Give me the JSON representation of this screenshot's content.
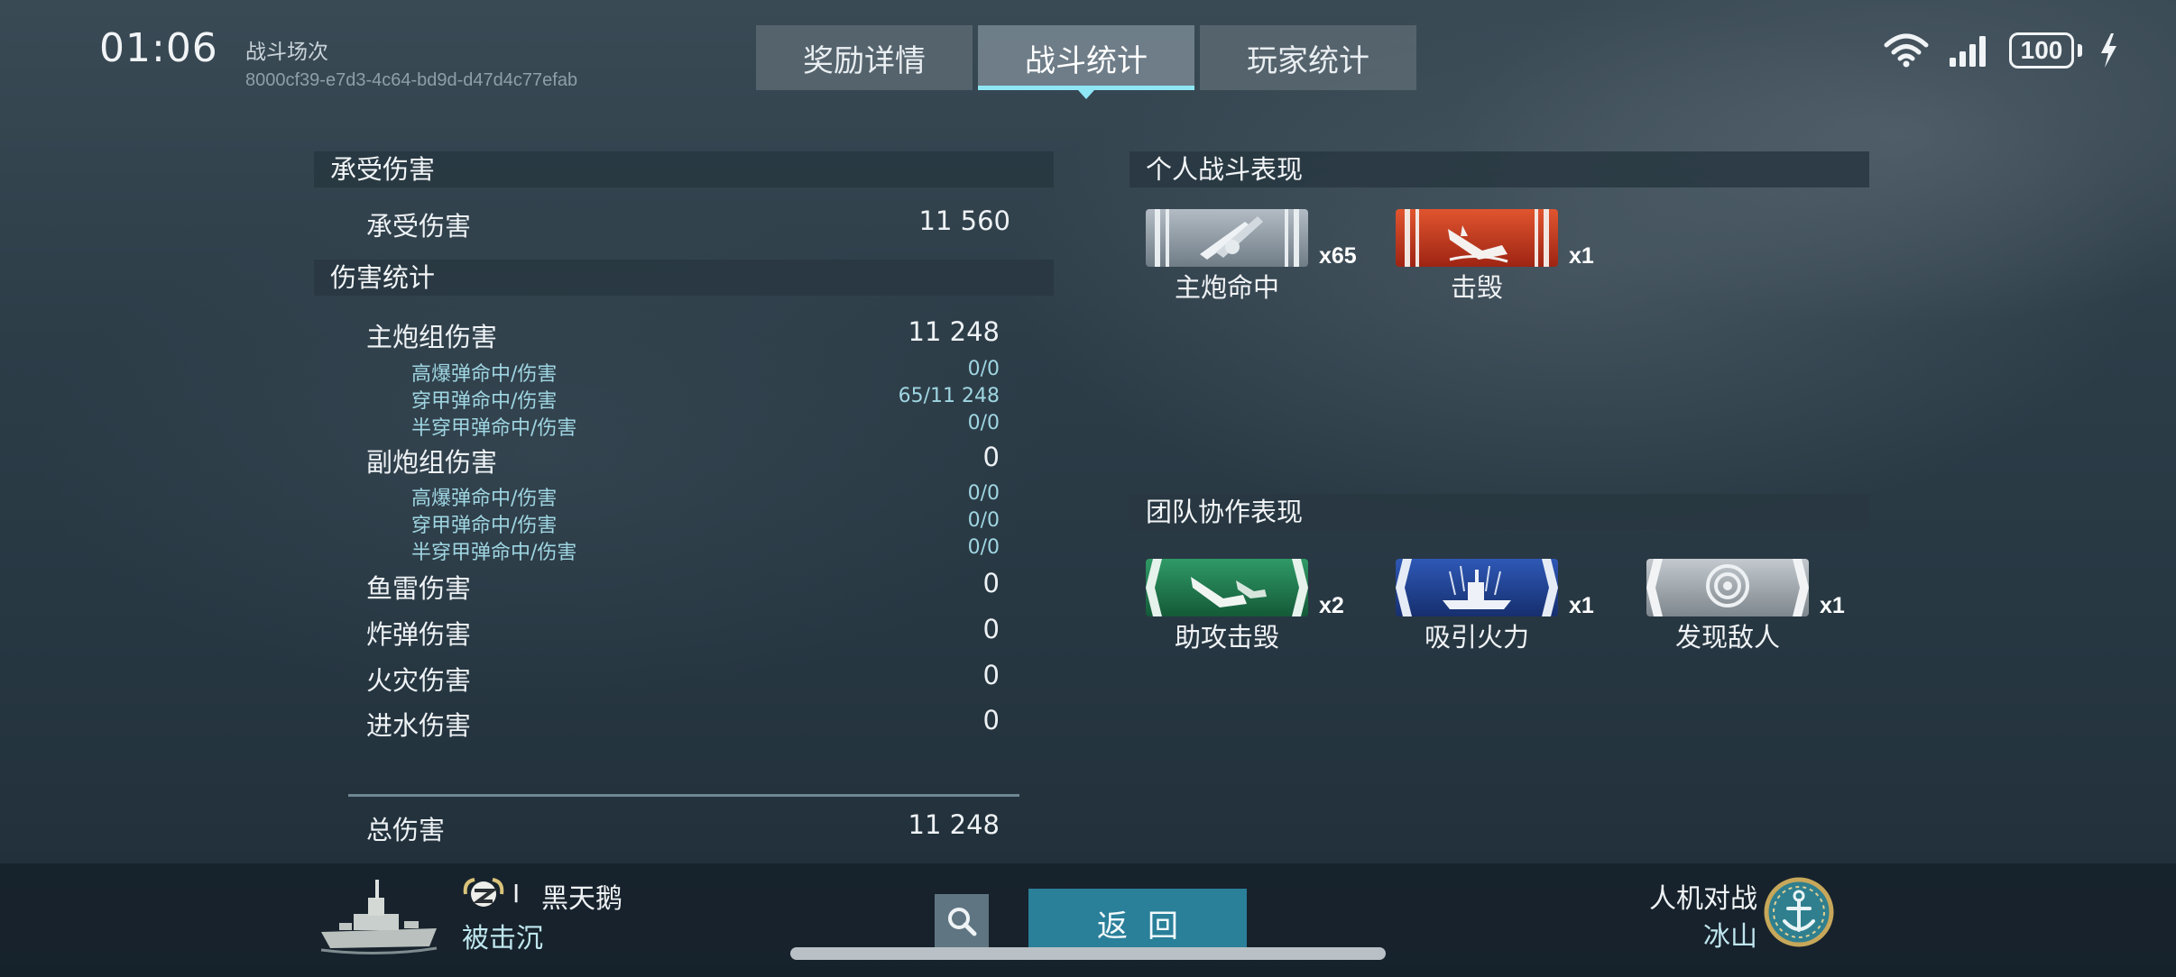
{
  "status": {
    "time": "01:06",
    "battery": "100",
    "icons": [
      "wifi-icon",
      "signal-icon",
      "battery-icon",
      "charging-bolt-icon"
    ]
  },
  "battle": {
    "label": "战斗场次",
    "id": "8000cf39-e7d3-4c64-bd9d-d47d4c77efab"
  },
  "tabs": [
    {
      "label": "奖励详情",
      "active": false
    },
    {
      "label": "战斗统计",
      "active": true
    },
    {
      "label": "玩家统计",
      "active": false
    }
  ],
  "damage_received": {
    "heading": "承受伤害",
    "label": "承受伤害",
    "value": "11 560"
  },
  "damage_stats": {
    "heading": "伤害统计",
    "main_battery": {
      "label": "主炮组伤害",
      "value": "11 248",
      "he": {
        "label": "高爆弹命中/伤害",
        "value": "0/0"
      },
      "ap": {
        "label": "穿甲弹命中/伤害",
        "value": "65/11 248"
      },
      "sap": {
        "label": "半穿甲弹命中/伤害",
        "value": "0/0"
      }
    },
    "secondary": {
      "label": "副炮组伤害",
      "value": "0",
      "he": {
        "label": "高爆弹命中/伤害",
        "value": "0/0"
      },
      "ap": {
        "label": "穿甲弹命中/伤害",
        "value": "0/0"
      },
      "sap": {
        "label": "半穿甲弹命中/伤害",
        "value": "0/0"
      }
    },
    "torpedo": {
      "label": "鱼雷伤害",
      "value": "0"
    },
    "bomb": {
      "label": "炸弹伤害",
      "value": "0"
    },
    "fire": {
      "label": "火灾伤害",
      "value": "0"
    },
    "flooding": {
      "label": "进水伤害",
      "value": "0"
    },
    "total": {
      "label": "总伤害",
      "value": "11 248"
    }
  },
  "personal": {
    "heading": "个人战斗表现",
    "medals": [
      {
        "name": "主炮命中",
        "count": "x65",
        "color": "#8e9aa4"
      },
      {
        "name": "击毁",
        "count": "x1",
        "color": "#c8371f"
      }
    ]
  },
  "team": {
    "heading": "团队协作表现",
    "medals": [
      {
        "name": "助攻击毁",
        "count": "x2",
        "color": "#1d7a4e"
      },
      {
        "name": "吸引火力",
        "count": "x1",
        "color": "#1e3f8e"
      },
      {
        "name": "发现敌人",
        "count": "x1",
        "color": "#9aa2a8"
      }
    ]
  },
  "player": {
    "tier": "I",
    "name": "黑天鹅",
    "status": "被击沉"
  },
  "bottom": {
    "back_label": "返回",
    "mode": "人机对战",
    "map": "冰山"
  }
}
